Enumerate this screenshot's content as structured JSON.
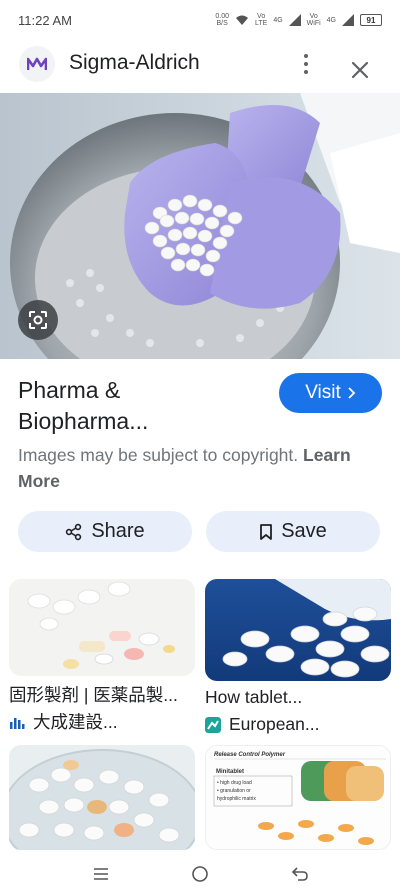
{
  "status_bar": {
    "time": "11:22 AM",
    "data_rate": "0.00\nB/S",
    "net1": "Vo\nLTE",
    "net2": "4G",
    "net3": "Vo\nWiFi",
    "net4": "4G",
    "battery": "91"
  },
  "header": {
    "site_name": "Sigma-Aldrich",
    "logo_glyph": "M",
    "more_icon": "more-vert-icon",
    "close_icon": "close-icon"
  },
  "hero": {
    "lens_icon": "lens-icon"
  },
  "result": {
    "title_line1": "Pharma &",
    "title_line2": "Biopharma...",
    "visit_label": "Visit",
    "copyright_text": "Images may be subject to copyright.",
    "learn_more": "Learn More"
  },
  "actions": {
    "share_label": "Share",
    "save_label": "Save"
  },
  "related": [
    {
      "title": "固形製剤 | 医薬品製...",
      "source": "大成建設..."
    },
    {
      "title": "How tablet...",
      "source": "European..."
    },
    {
      "title": "",
      "source": ""
    },
    {
      "title": "Release Control Polymer",
      "source": ""
    }
  ],
  "related_art": {
    "doc_title": "Release Control Polymer",
    "doc_sub": "Minitablet",
    "doc_bullets": [
      "• high drug load",
      "• granulation or",
      "  hydrophilic matrix"
    ]
  },
  "colors": {
    "accent": "#1a73e8",
    "chip_bg": "#e8eefa",
    "logo_purple": "#6f42c1"
  }
}
